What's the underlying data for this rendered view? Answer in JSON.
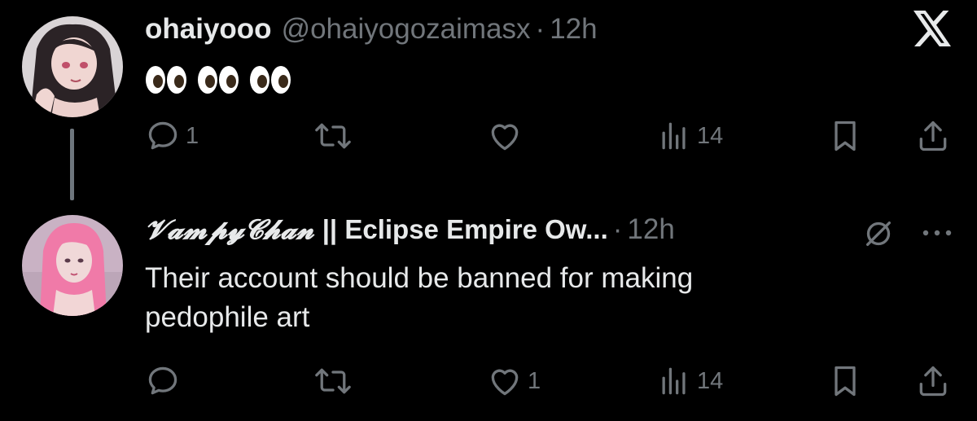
{
  "tweet1": {
    "display_name": "ohaiyooo",
    "handle": "@ohaiyogozaimasx",
    "separator": "·",
    "time": "12h",
    "content_emoji": [
      "👀",
      "👀",
      "👀"
    ],
    "avatar_icon": "avatar-image",
    "actions": {
      "reply_count": "1",
      "retweet_count": "",
      "like_count": "",
      "views_count": "14"
    }
  },
  "tweet2": {
    "display_name_fancy": "𝓥𝓪𝓶𝓹𝔂𝓒𝓱𝓪𝓷",
    "display_name_rest": "|| Eclipse Empire Ow...",
    "separator": "·",
    "time": "12h",
    "content_lines": [
      "Their account should be banned for making",
      "pedophile art"
    ],
    "avatar_icon": "avatar-image",
    "actions": {
      "reply_count": "",
      "retweet_count": "",
      "like_count": "1",
      "views_count": "14"
    }
  },
  "brand_icon": "x-logo-icon",
  "colors": {
    "background": "#000000",
    "text_primary": "#e7e9ea",
    "text_secondary": "#71767b",
    "thread_line": "#6e767d"
  }
}
